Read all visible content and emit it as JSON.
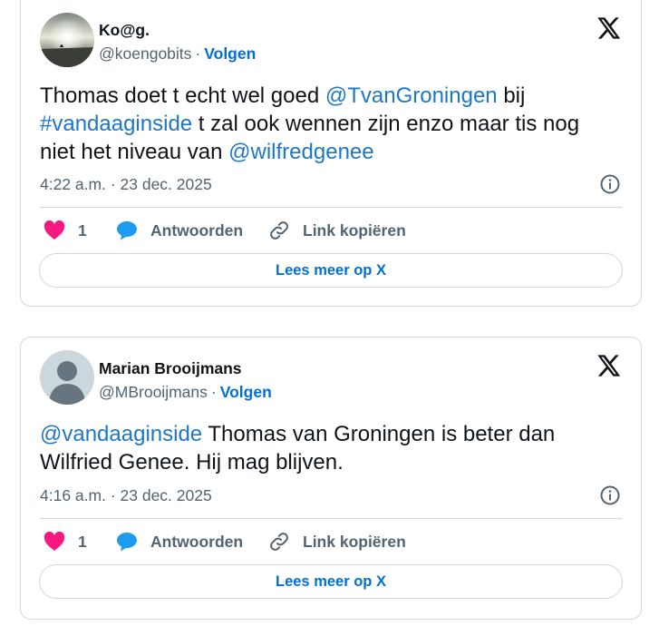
{
  "tweets": [
    {
      "name": "Ko@g.",
      "handle": "@koengobits",
      "separator": "·",
      "follow_label": "Volgen",
      "body": [
        {
          "t": "text",
          "v": "Thomas doet t echt wel goed "
        },
        {
          "t": "link",
          "v": "@TvanGroningen"
        },
        {
          "t": "text",
          "v": " bij "
        },
        {
          "t": "link",
          "v": "#vandaaginside"
        },
        {
          "t": "text",
          "v": " t zal ook wennen zijn enzo maar tis nog niet het niveau van "
        },
        {
          "t": "link",
          "v": "@wilfredgenee"
        }
      ],
      "timestamp": "4:22 a.m. · 23 dec. 2025",
      "like_count": "1",
      "reply_label": "Antwoorden",
      "copy_link_label": "Link kopiëren",
      "read_more_label": "Lees meer op X",
      "avatar_icon": "landscape-photo-avatar"
    },
    {
      "name": "Marian Brooijmans",
      "handle": "@MBrooijmans",
      "separator": "·",
      "follow_label": "Volgen",
      "body": [
        {
          "t": "link",
          "v": "@vandaaginside"
        },
        {
          "t": "text",
          "v": " Thomas van Groningen is beter dan Wilfried Genee. Hij mag blijven."
        }
      ],
      "timestamp": "4:16 a.m. · 23 dec. 2025",
      "like_count": "1",
      "reply_label": "Antwoorden",
      "copy_link_label": "Link kopiëren",
      "read_more_label": "Lees meer op X",
      "avatar_icon": "default-user-avatar"
    }
  ],
  "colors": {
    "link": "#1d77c9",
    "follow": "#006fd6",
    "heart": "#f91880",
    "reply_bubble": "#1d9bf0",
    "muted": "#536471",
    "border": "#cfd9de"
  },
  "icons": [
    "x-logo-icon",
    "info-icon",
    "heart-icon",
    "reply-bubble-icon",
    "link-icon"
  ]
}
